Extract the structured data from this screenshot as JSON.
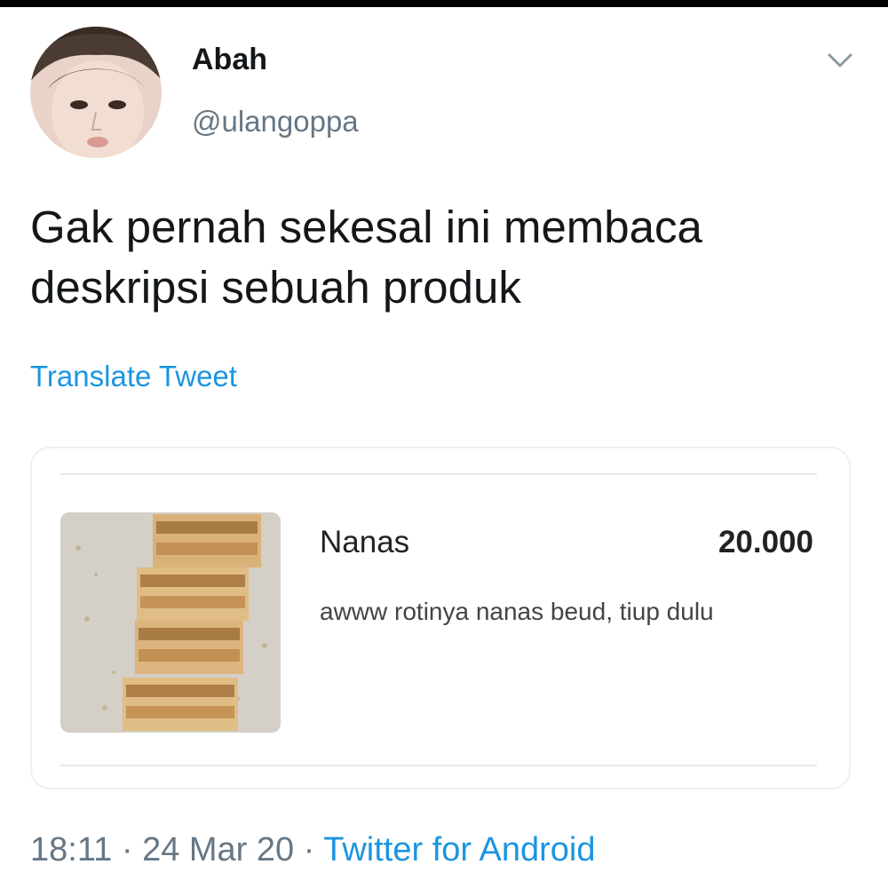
{
  "user": {
    "display_name": "Abah",
    "handle": "@ulangoppa"
  },
  "tweet": {
    "text": "Gak pernah sekesal ini membaca deskripsi sebuah produk",
    "translate_label": "Translate Tweet"
  },
  "product_card": {
    "name": "Nanas",
    "price": "20.000",
    "description": "awww rotinya nanas beud, tiup dulu"
  },
  "meta": {
    "time": "18:11",
    "separator": "·",
    "date": "24 Mar 20",
    "source": "Twitter for Android"
  },
  "icons": {
    "caret": "chevron-down-icon"
  },
  "colors": {
    "link": "#1b95e0",
    "secondary_text": "#657786",
    "primary_text": "#14171a"
  }
}
